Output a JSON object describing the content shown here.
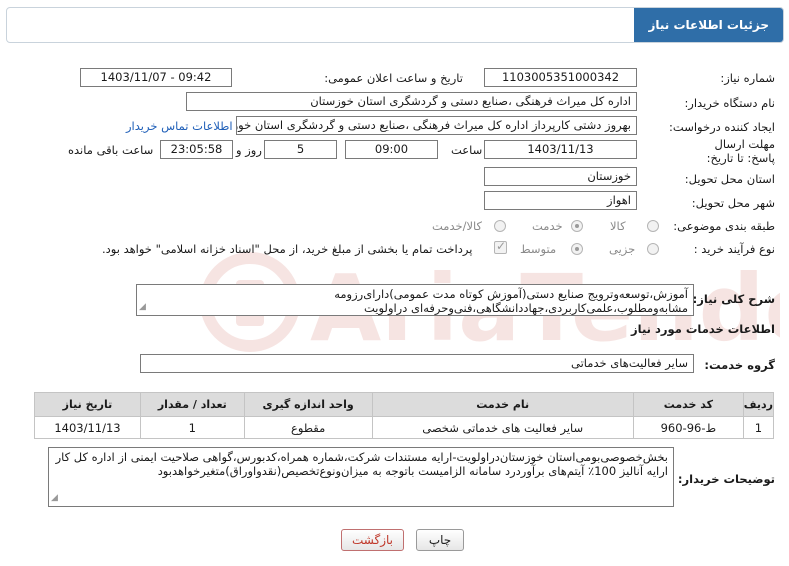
{
  "header": {
    "title": "جزئیات اطلاعات نیاز"
  },
  "fields": {
    "need_number_label": "شماره نیاز:",
    "need_number": "1103005351000342",
    "announce_label": "تاریخ و ساعت اعلان عمومی:",
    "announce_value": "1403/11/07 - 09:42",
    "buyer_org_label": "نام دستگاه خریدار:",
    "buyer_org": "اداره کل میراث فرهنگی ،صنایع دستی و گردشگری استان خوزستان",
    "creator_label": "ایجاد کننده درخواست:",
    "creator": "بهروز دشتی کارپرداز اداره کل میراث فرهنگی ،صنایع دستی و گردشگری استان خوزستان",
    "contact_link": "اطلاعات تماس خریدار",
    "deadline_label": "مهلت ارسال پاسخ: تا تاریخ:",
    "deadline_date": "1403/11/13",
    "time_label": "ساعت",
    "deadline_time": "09:00",
    "days_value": "5",
    "days_label": "روز و",
    "remaining_time": "23:05:58",
    "remaining_label": "ساعت باقی مانده",
    "province_label": "استان محل تحویل:",
    "province": "خوزستان",
    "city_label": "شهر محل تحویل:",
    "city": "اهواز",
    "category_label": "طبقه بندی موضوعی:",
    "category_options": [
      "کالا",
      "خدمت",
      "کالا/خدمت"
    ],
    "category_selected": "خدمت",
    "process_label": "نوع فرآیند خرید :",
    "process_options": [
      "جزیی",
      "متوسط"
    ],
    "process_selected": "متوسط",
    "payment_note": "پرداخت تمام یا بخشی از مبلغ خرید، از محل \"اسناد خزانه اسلامی\" خواهد بود."
  },
  "description": {
    "label": "شرح کلی نیاز:",
    "text": "آموزش،توسعه‌وترویج صنایع دستی(آموزش کوتاه مدت عمومی)دارای‌رزومه مشابه‌ومطلوب،علمی‌کاربردی،جهاددانشگاهی،فنی‌وحرفه‌ای دراولویت"
  },
  "services_section": {
    "title": "اطلاعات خدمات مورد نیاز",
    "group_label": "گروه خدمت:",
    "group_value": "سایر فعالیت‌های خدماتی"
  },
  "table": {
    "headers": [
      "ردیف",
      "کد خدمت",
      "نام خدمت",
      "واحد اندازه گیری",
      "تعداد / مقدار",
      "تاریخ نیاز"
    ],
    "rows": [
      [
        "1",
        "ط-96-960",
        "سایر فعالیت های خدماتی شخصی",
        "مقطوع",
        "1",
        "1403/11/13"
      ]
    ]
  },
  "buyer_notes": {
    "label": "توضیحات خریدار:",
    "text": "بخش‌خصوصی‌بومی‌استان خوزستان‌دراولویت-ارایه مستندات شرکت،شماره همراه،کدبورس،گواهی صلاحیت ایمنی از اداره کل کار ارایه آنالیز 100٪ آیتم‌های برآوردرد سامانه الزامیست باتوجه به میزان‌ونوع‌تخصیص(نقدواوراق)متغیرخواهدبود"
  },
  "buttons": {
    "print": "چاپ",
    "back": "بازگشت"
  },
  "colors": {
    "header_bg": "#2f6ea8",
    "link": "#1f5fb8",
    "back_text": "#c0392b"
  }
}
